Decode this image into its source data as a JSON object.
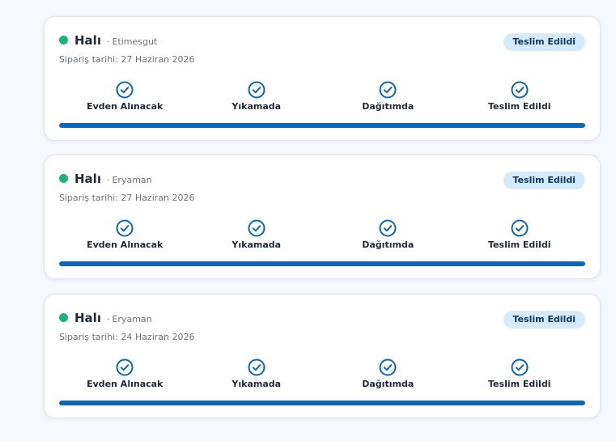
{
  "colors": {
    "accent": "#0b68b8",
    "status_dot": "#1cb37a",
    "badge_bg": "#d6ebfa",
    "badge_text": "#0b3a66"
  },
  "separator": "·",
  "orders": [
    {
      "service": "Halı",
      "district": "Etimesgut",
      "date_line": "Sipariş tarihi: 27 Haziran 2026",
      "status": "Teslim Edildi",
      "progress": 1.0,
      "steps": [
        {
          "label": "Evden Alınacak",
          "icon": "check-circle-icon"
        },
        {
          "label": "Yıkamada",
          "icon": "check-circle-icon"
        },
        {
          "label": "Dağıtımda",
          "icon": "check-circle-icon"
        },
        {
          "label": "Teslim Edildi",
          "icon": "check-circle-icon"
        }
      ]
    },
    {
      "service": "Halı",
      "district": "Eryaman",
      "date_line": "Sipariş tarihi: 27 Haziran 2026",
      "status": "Teslim Edildi",
      "progress": 1.0,
      "steps": [
        {
          "label": "Evden Alınacak",
          "icon": "check-circle-icon"
        },
        {
          "label": "Yıkamada",
          "icon": "check-circle-icon"
        },
        {
          "label": "Dağıtımda",
          "icon": "check-circle-icon"
        },
        {
          "label": "Teslim Edildi",
          "icon": "check-circle-icon"
        }
      ]
    },
    {
      "service": "Halı",
      "district": "Eryaman",
      "date_line": "Sipariş tarihi: 24 Haziran 2026",
      "status": "Teslim Edildi",
      "progress": 1.0,
      "steps": [
        {
          "label": "Evden Alınacak",
          "icon": "check-circle-icon"
        },
        {
          "label": "Yıkamada",
          "icon": "check-circle-icon"
        },
        {
          "label": "Dağıtımda",
          "icon": "check-circle-icon"
        },
        {
          "label": "Teslim Edildi",
          "icon": "check-circle-icon"
        }
      ]
    }
  ]
}
